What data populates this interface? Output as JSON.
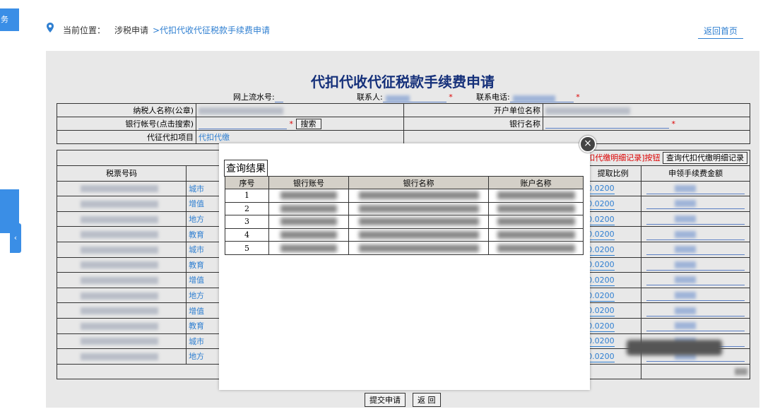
{
  "sidebar": {
    "top_tab": "务",
    "collapse_arrow": "‹"
  },
  "breadcrumb": {
    "prefix": "当前位置：",
    "section": "涉税申请",
    "current": ">代扣代收代征税款手续费申请",
    "home": "返回首页"
  },
  "form": {
    "title": "代扣代收代征税款手续费申请",
    "serial_label": "网上流水号:",
    "contact_label": "联系人:",
    "phone_label": "联系电话:",
    "required_mark": "*",
    "taxpayer_label": "纳税人名称(公章)",
    "account_unit_label": "开户单位名称",
    "bank_account_label": "银行帐号(点击搜索)",
    "search_btn": "搜索",
    "bank_name_label": "银行名称",
    "item_label": "代征代扣项目",
    "item_value": "代扣代缴",
    "note_text": "扣代缴明细记录]按钮",
    "query_btn": "查询代扣代缴明细记录",
    "columns": {
      "ticket_no": "税票号码",
      "ratio": "提取比例",
      "fee": "申领手续费金额"
    },
    "rows": [
      {
        "tax": "城市",
        "ratio": "0.0200"
      },
      {
        "tax": "增值",
        "ratio": "0.0200"
      },
      {
        "tax": "地方",
        "ratio": "0.0200"
      },
      {
        "tax": "教育",
        "ratio": "0.0200"
      },
      {
        "tax": "城市",
        "ratio": "0.0200"
      },
      {
        "tax": "教育",
        "ratio": "0.0200"
      },
      {
        "tax": "增值",
        "ratio": "0.0200"
      },
      {
        "tax": "地方",
        "ratio": "0.0200"
      },
      {
        "tax": "增值",
        "ratio": "0.0200"
      },
      {
        "tax": "教育",
        "ratio": "0.0200"
      },
      {
        "tax": "城市",
        "ratio": "0.0200"
      },
      {
        "tax": "地方",
        "ratio": "0.0200"
      }
    ],
    "submit_btn": "提交申请",
    "back_btn": "返 回"
  },
  "modal": {
    "title": "查询结果",
    "close": "×",
    "columns": [
      "序号",
      "银行账号",
      "银行名称",
      "账户名称"
    ],
    "rows": [
      "1",
      "2",
      "3",
      "4",
      "5"
    ]
  },
  "colors": {
    "accent": "#3a8ee6",
    "title": "#15307a",
    "link": "#2f7fd1",
    "required": "#dd0000"
  }
}
